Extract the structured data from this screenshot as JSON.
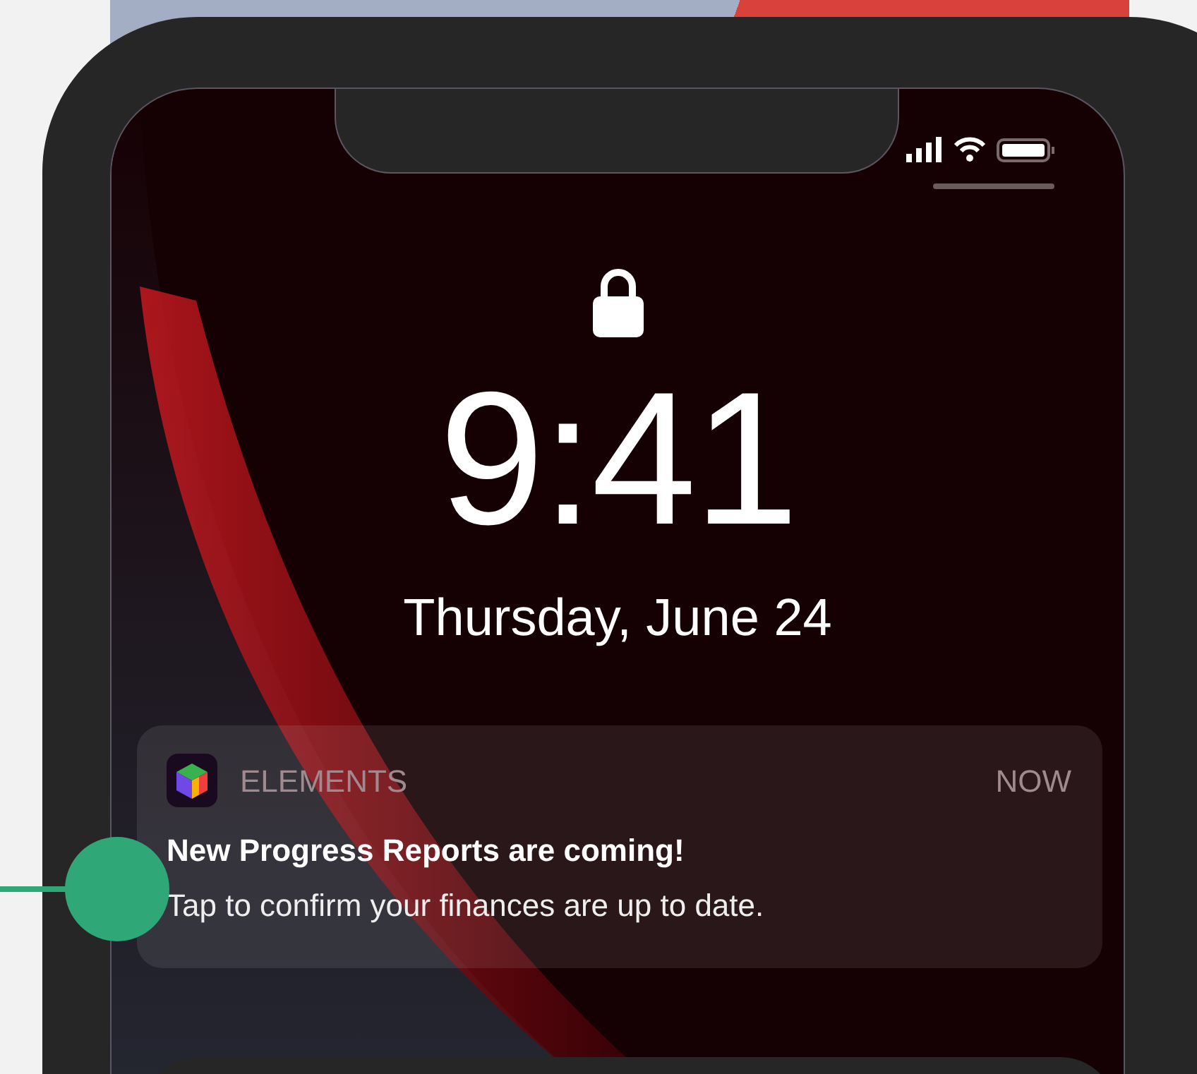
{
  "lock_screen": {
    "time": "9:41",
    "date": "Thursday, June 24"
  },
  "notification": {
    "app_name": "ELEMENTS",
    "time": "NOW",
    "title": "New Progress Reports are coming!",
    "body": "Tap to confirm your finances are up to date."
  }
}
